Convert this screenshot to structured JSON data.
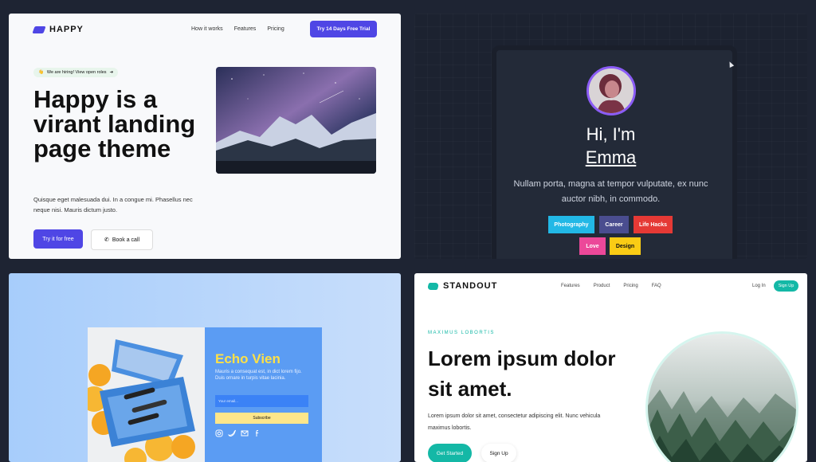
{
  "happy": {
    "brand": "HAPPY",
    "nav": [
      "How it works",
      "Features",
      "Pricing"
    ],
    "cta": "Try 14 Days Free Trial",
    "badge": "We are hiring! View open roles",
    "badge_icon": "waving-hand-icon",
    "headline": "Happy is a virant landing page theme",
    "subtext": "Quisque eget malesuada dui. In a congue mi. Phasellus nec neque nisi. Mauris dictum justo.",
    "btn_primary": "Try it for free",
    "btn_secondary": "Book a call",
    "accent": "#4f46e5"
  },
  "emma": {
    "greeting": "Hi, I'm",
    "name": "Emma",
    "description": "Nullam porta, magna at tempor vulputate, ex nunc auctor nibh, in commodo.",
    "tags": [
      {
        "label": "Photography",
        "color": "#22b8e6"
      },
      {
        "label": "Career",
        "color": "#4a4d8f"
      },
      {
        "label": "Life Hacks",
        "color": "#e53935"
      },
      {
        "label": "Love",
        "color": "#ec4899"
      },
      {
        "label": "Design",
        "color": "#facc15"
      }
    ]
  },
  "echo": {
    "title": "Echo Vien",
    "description": "Mauris a consequat est, in dict lorem fijo. Duis ornare in turpis vitae lacinia.",
    "email_placeholder": "Your email...",
    "subscribe": "Subscribe",
    "social": [
      "instagram-icon",
      "twitter-icon",
      "mail-icon",
      "facebook-icon"
    ]
  },
  "standout": {
    "brand": "STANDOUT",
    "nav": [
      "Features",
      "Product",
      "Pricing",
      "FAQ"
    ],
    "login": "Log In",
    "signup": "Sign Up",
    "eyebrow": "MAXIMUS LOBORTIS",
    "headline": "Lorem ipsum dolor sit amet.",
    "subtext": "Lorem ipsum dolor sit amet, consectetur adipiscing elit. Nunc vehicula maximus lobortis.",
    "btn_primary": "Get Started",
    "btn_secondary": "Sign Up",
    "accent": "#14b8a6"
  }
}
